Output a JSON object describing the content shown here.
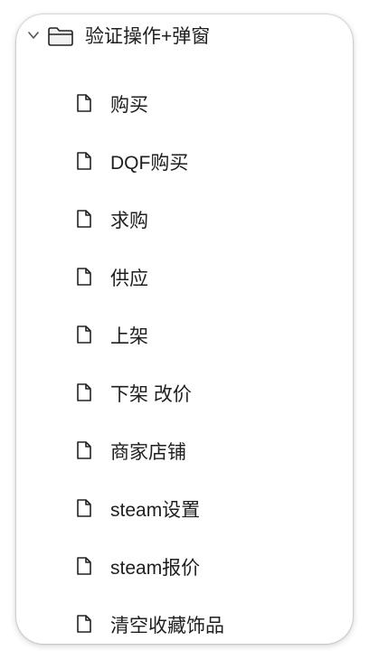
{
  "tree": {
    "folder": {
      "label": "验证操作+弹窗",
      "icon": "folder-icon",
      "expanded": true
    },
    "items": [
      {
        "label": "购买",
        "icon": "file-icon"
      },
      {
        "label": "DQF购买",
        "icon": "file-icon"
      },
      {
        "label": "求购",
        "icon": "file-icon"
      },
      {
        "label": "供应",
        "icon": "file-icon"
      },
      {
        "label": "上架",
        "icon": "file-icon"
      },
      {
        "label": "下架 改价",
        "icon": "file-icon"
      },
      {
        "label": "商家店铺",
        "icon": "file-icon"
      },
      {
        "label": "steam设置",
        "icon": "file-icon"
      },
      {
        "label": "steam报价",
        "icon": "file-icon"
      },
      {
        "label": "清空收藏饰品",
        "icon": "file-icon"
      }
    ]
  },
  "colors": {
    "text": "#1f1f1f",
    "icon_stroke": "#222222",
    "panel_bg": "#ffffff"
  }
}
